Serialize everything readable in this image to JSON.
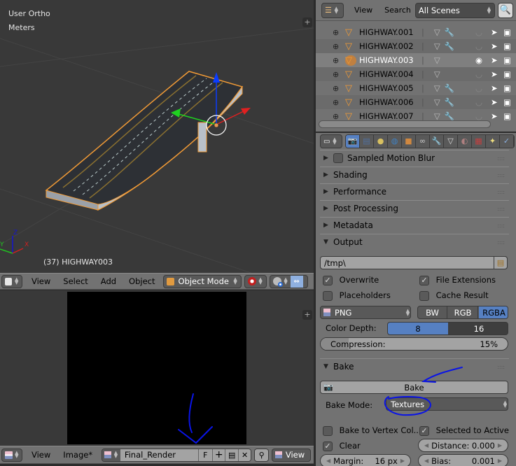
{
  "viewport": {
    "view_name": "User Ortho",
    "units": "Meters",
    "object_label": "(37) HIGHWAY003",
    "axis_labels": {
      "x": "X",
      "y": "Y",
      "z": "Z"
    }
  },
  "viewport_header": {
    "editor_icon": "3d-view-icon",
    "menus": [
      "View",
      "Select",
      "Add",
      "Object"
    ],
    "mode": "Object Mode",
    "shading_icon": "viewport-shading-icon",
    "pivot_icon": "pivot-point-icon",
    "manipulator_icon": "manipulator-icon"
  },
  "image_header": {
    "editor_icon": "image-editor-icon",
    "menus": [
      "View",
      "Image*"
    ],
    "image_name": "Final_Render",
    "fake_user": "F",
    "view_label": "View"
  },
  "outliner": {
    "header": {
      "menus": [
        "View",
        "Search"
      ],
      "scene_filter": "All Scenes"
    },
    "rows": [
      {
        "name": "HIGHWAY.001",
        "modifier": true,
        "visible": false,
        "selected": false
      },
      {
        "name": "HIGHWAY.002",
        "modifier": true,
        "visible": false,
        "selected": false
      },
      {
        "name": "HIGHWAY.003",
        "modifier": false,
        "visible": true,
        "selected": true
      },
      {
        "name": "HIGHWAY.004",
        "modifier": false,
        "visible": false,
        "selected": false
      },
      {
        "name": "HIGHWAY.005",
        "modifier": true,
        "visible": false,
        "selected": false
      },
      {
        "name": "HIGHWAY.006",
        "modifier": true,
        "visible": false,
        "selected": false
      },
      {
        "name": "HIGHWAY.007",
        "modifier": true,
        "visible": false,
        "selected": false
      }
    ]
  },
  "properties": {
    "tabs": [
      "render",
      "render-layers",
      "scene",
      "world",
      "object",
      "constraints",
      "modifiers",
      "data",
      "material",
      "texture",
      "particles",
      "physics"
    ],
    "active_tab": "render",
    "collapsed_panels": [
      "Sampled Motion Blur",
      "Shading",
      "Performance",
      "Post Processing",
      "Metadata"
    ],
    "output": {
      "title": "Output",
      "path": "/tmp\\",
      "overwrite": {
        "label": "Overwrite",
        "checked": true
      },
      "file_extensions": {
        "label": "File Extensions",
        "checked": true
      },
      "placeholders": {
        "label": "Placeholders",
        "checked": false
      },
      "cache_result": {
        "label": "Cache Result",
        "checked": false
      },
      "format": "PNG",
      "color_modes": [
        "BW",
        "RGB",
        "RGBA"
      ],
      "color_mode_active": "RGBA",
      "color_depth_label": "Color Depth:",
      "color_depths": [
        "8",
        "16"
      ],
      "color_depth_active": "8",
      "compression_label": "Compression:",
      "compression_value": "15%",
      "compression_fraction": 0.15
    },
    "bake": {
      "title": "Bake",
      "bake_button": "Bake",
      "bake_mode_label": "Bake Mode:",
      "bake_mode": "Textures",
      "bake_to_vertex": {
        "label": "Bake to Vertex Col...",
        "checked": false
      },
      "selected_to_active": {
        "label": "Selected to Active",
        "checked": true
      },
      "clear": {
        "label": "Clear",
        "checked": true
      },
      "distance_label": "Distance:",
      "distance_value": "0.000",
      "margin_label": "Margin:",
      "margin_value": "16 px",
      "bias_label": "Bias:",
      "bias_value": "0.001"
    }
  },
  "colors": {
    "accent_blue": "#5680c2",
    "selection_orange": "#f09a36",
    "annotation_blue": "#0a14e6"
  }
}
